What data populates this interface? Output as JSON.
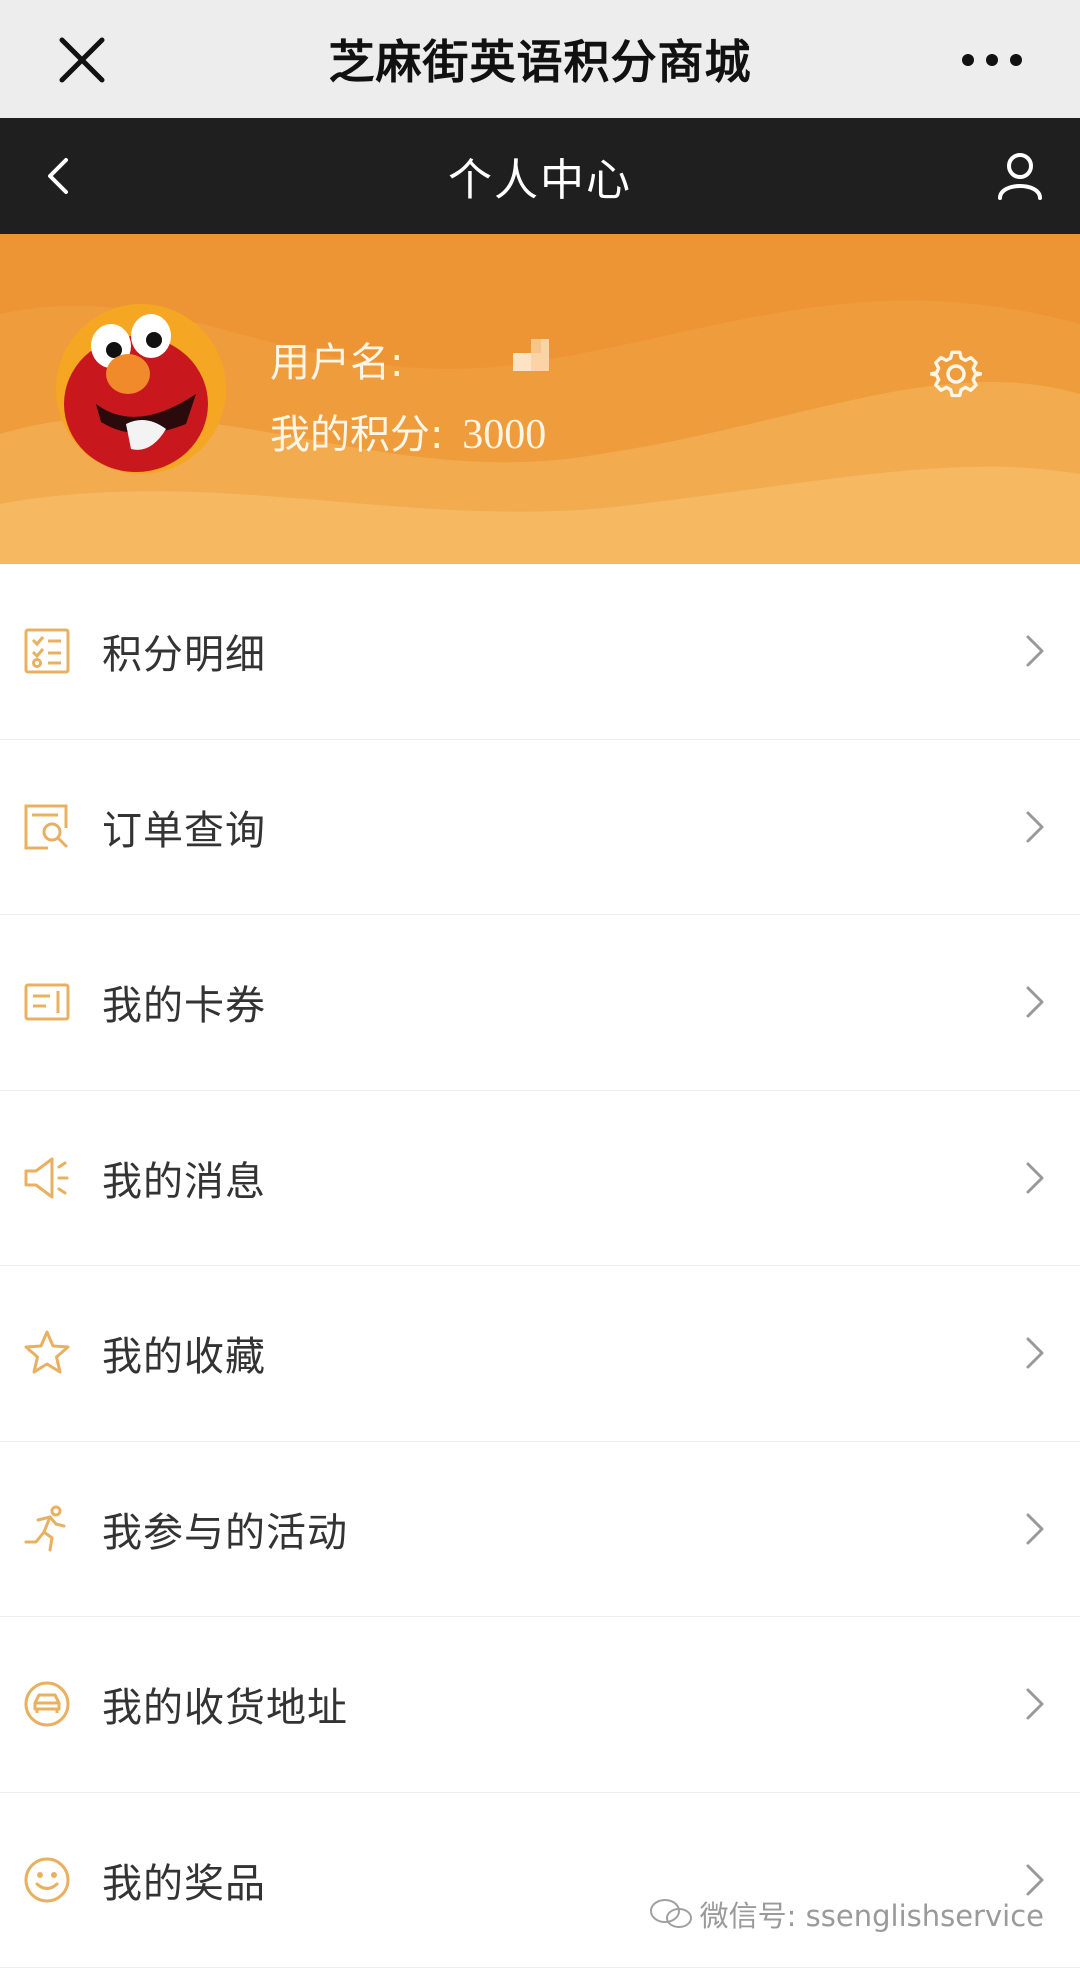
{
  "wechat_bar": {
    "title": "芝麻街英语积分商城",
    "close_icon": "close-icon",
    "more_icon": "more-icon"
  },
  "nav": {
    "title": "个人中心",
    "back_icon": "chevron-left-icon",
    "user_icon": "user-icon"
  },
  "profile": {
    "username_label": "用户名:",
    "points_label": "我的积分:",
    "points_value": "3000",
    "avatar": "elmo-avatar",
    "settings_icon": "gear-icon",
    "colors": {
      "background": "#ed9435",
      "text": "#fff6e8"
    }
  },
  "menu": {
    "items": [
      {
        "label": "积分明细",
        "icon": "points-detail-icon"
      },
      {
        "label": "订单查询",
        "icon": "order-search-icon"
      },
      {
        "label": "我的卡券",
        "icon": "coupon-icon"
      },
      {
        "label": "我的消息",
        "icon": "megaphone-icon"
      },
      {
        "label": "我的收藏",
        "icon": "star-icon"
      },
      {
        "label": "我参与的活动",
        "icon": "running-icon"
      },
      {
        "label": "我的收货地址",
        "icon": "address-icon"
      },
      {
        "label": "我的奖品",
        "icon": "smiley-icon"
      }
    ],
    "icon_color": "#e8b060"
  },
  "watermark": {
    "text": "微信号: ssenglishservice"
  }
}
